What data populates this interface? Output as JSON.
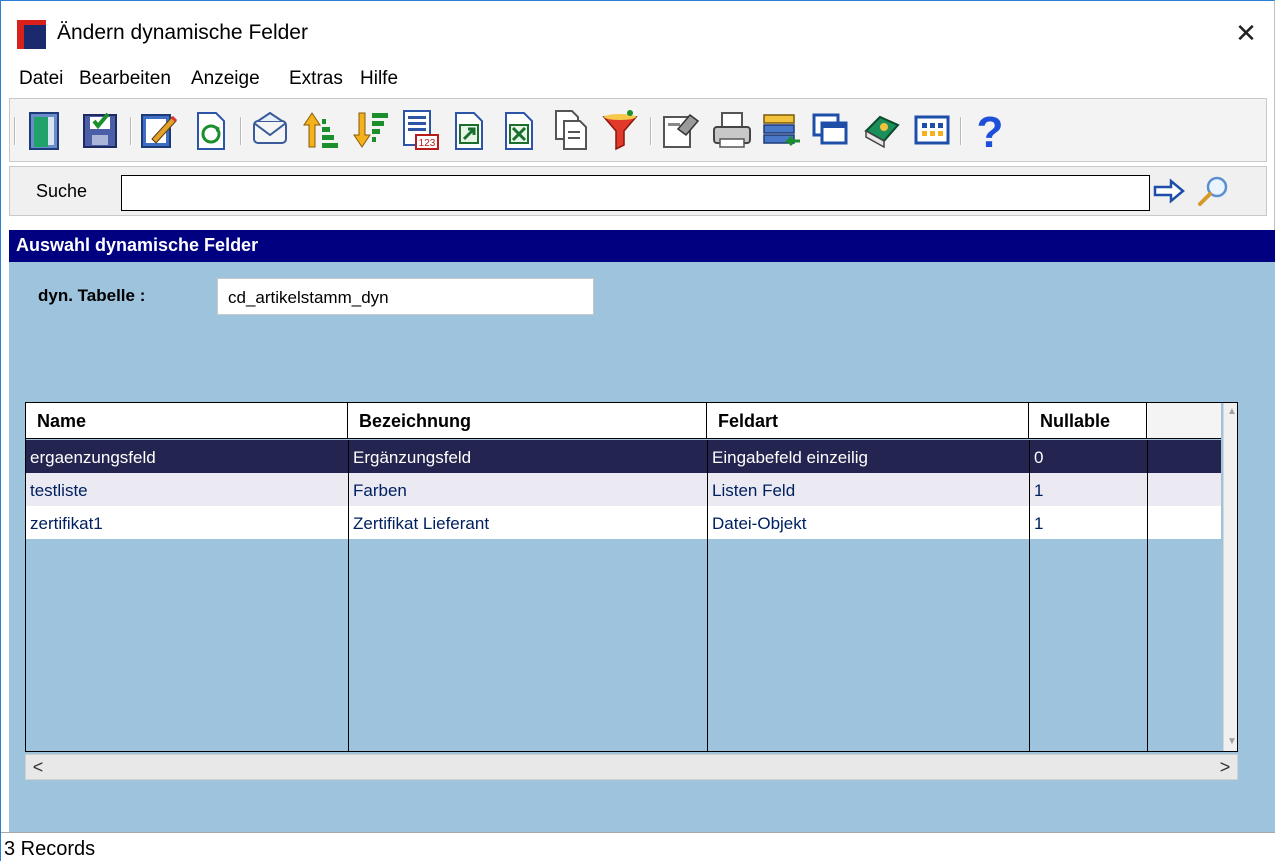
{
  "window": {
    "title": "Ändern dynamische Felder",
    "close_glyph": "✕"
  },
  "menu": {
    "items": [
      "Datei",
      "Bearbeiten",
      "Anzeige",
      "Extras",
      "Hilfe"
    ]
  },
  "toolbar": {
    "buttons": [
      "exit-door-icon",
      "save-icon",
      "edit-icon",
      "refresh-icon",
      "mail-icon",
      "sort-ascending-icon",
      "sort-descending-icon",
      "number-format-icon",
      "export-icon",
      "excel-export-icon",
      "copy-icon",
      "filter-icon",
      "properties-icon",
      "print-icon",
      "transfer-icon",
      "windows-icon",
      "book-icon",
      "calendar-grid-icon",
      "help-icon"
    ]
  },
  "search": {
    "label": "Suche",
    "value": "",
    "go_icon": "arrow-right-icon",
    "find_icon": "magnifier-icon"
  },
  "panel": {
    "title": "Auswahl dynamische Felder",
    "dyn_table_label": "dyn. Tabelle :",
    "dyn_table_value": "cd_artikelstamm_dyn"
  },
  "grid": {
    "columns": [
      "Name",
      "Bezeichnung",
      "Feldart",
      "Nullable"
    ],
    "rows": [
      {
        "name": "ergaenzungsfeld",
        "bezeichnung": "Ergänzungsfeld",
        "feldart": "Eingabefeld einzeilig",
        "nullable": "0",
        "selected": true
      },
      {
        "name": "testliste",
        "bezeichnung": "Farben",
        "feldart": "Listen Feld",
        "nullable": "1",
        "selected": false
      },
      {
        "name": "zertifikat1",
        "bezeichnung": "Zertifikat Lieferant",
        "feldart": "Datei-Objekt",
        "nullable": "1",
        "selected": false
      }
    ],
    "scroll_left": "<",
    "scroll_right": ">"
  },
  "status": {
    "text": "3 Records"
  },
  "colors": {
    "panel_bg": "#9dc3dd",
    "header_bg": "#000080",
    "selected_row": "#23244f",
    "alt_row": "#ebeaf2"
  }
}
